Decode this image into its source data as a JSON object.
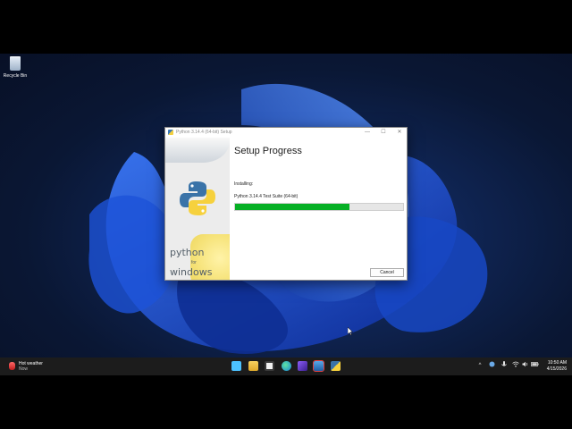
{
  "desktop": {
    "recycle_bin_label": "Recycle Bin"
  },
  "window": {
    "title": "Python 3.14.4 (64-bit) Setup",
    "heading": "Setup Progress",
    "status_label": "Installing:",
    "current_item": "Python 3.14.4 Test Suite (64-bit)",
    "progress_fraction": 0.68,
    "cancel_label": "Cancel",
    "brand": {
      "python_text": "python",
      "for_text": "for",
      "windows_text": "windows"
    },
    "controls": {
      "minimize_glyph": "—",
      "maximize_glyph": "☐",
      "close_glyph": "✕"
    }
  },
  "taskbar": {
    "weather": {
      "title": "Hot weather",
      "subtitle": "Now"
    },
    "apps": [
      "start-icon",
      "file-explorer-icon",
      "store-icon",
      "edge-icon",
      "app-icon",
      "terminal-icon",
      "python-installer-icon"
    ],
    "tray": {
      "chevron_glyph": "^"
    },
    "clock": {
      "time": "10:50 AM",
      "date": "4/15/2026"
    }
  },
  "colors": {
    "progress_fill": "#06b025",
    "taskbar_bg": "#1c1c1c"
  }
}
